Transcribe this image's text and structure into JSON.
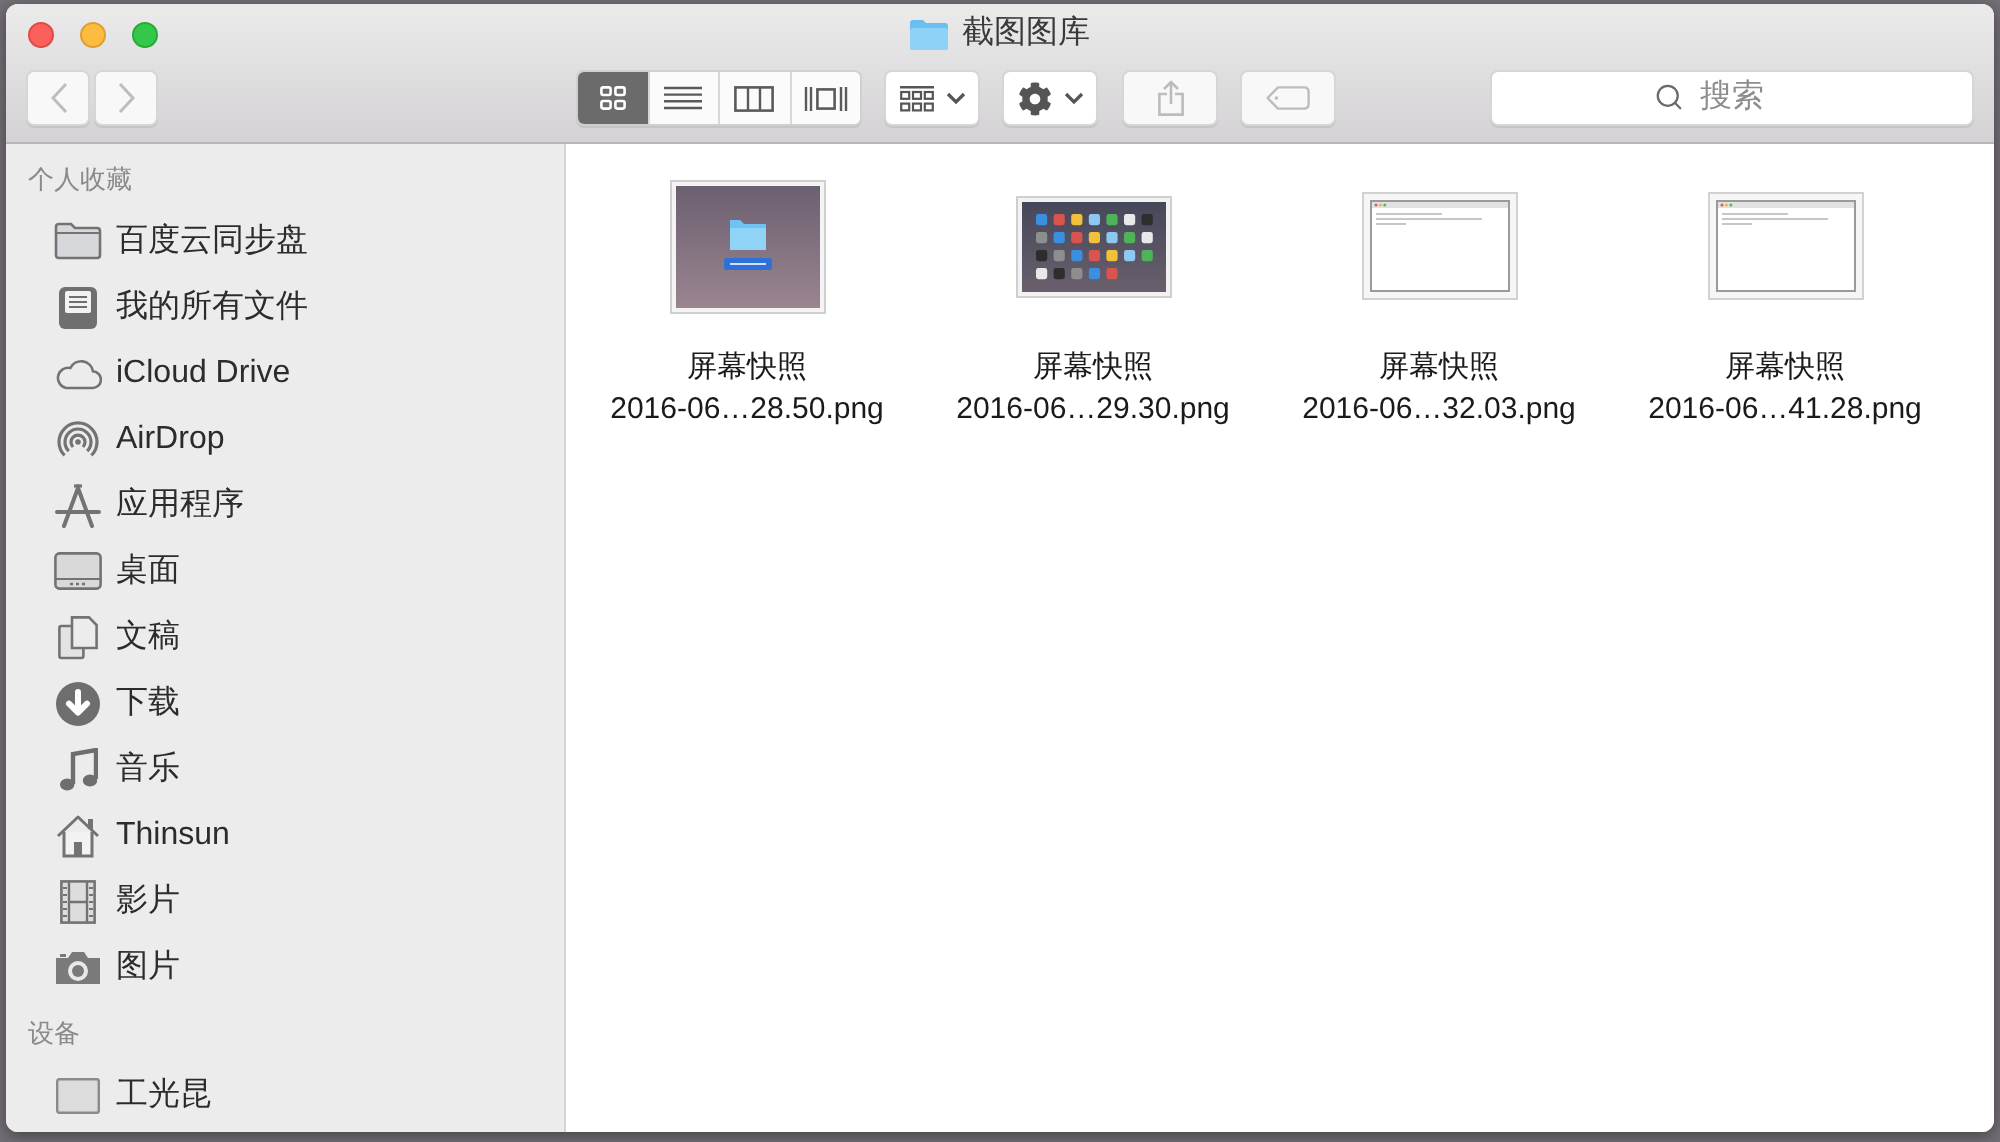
{
  "window": {
    "title": "截图图库"
  },
  "toolbar": {
    "navigation": [
      {
        "kind": "back",
        "disabled": true
      },
      {
        "kind": "forward",
        "disabled": true
      }
    ],
    "view_modes": [
      {
        "kind": "icon",
        "selected": true
      },
      {
        "kind": "list",
        "selected": false
      },
      {
        "kind": "column",
        "selected": false
      },
      {
        "kind": "cover_flow",
        "selected": false
      }
    ],
    "buttons": [
      {
        "kind": "arrange",
        "disabled": false
      },
      {
        "kind": "action",
        "disabled": false
      },
      {
        "kind": "share",
        "disabled": true
      },
      {
        "kind": "tag",
        "disabled": true
      }
    ],
    "search": {
      "placeholder": "搜索"
    }
  },
  "sidebar": {
    "sections": [
      {
        "title": "个人收藏",
        "items": [
          {
            "kind": "folder",
            "label": "百度云同步盘"
          },
          {
            "kind": "all_files",
            "label": "我的所有文件"
          },
          {
            "kind": "icloud",
            "label": "iCloud Drive"
          },
          {
            "kind": "airdrop",
            "label": "AirDrop"
          },
          {
            "kind": "applications",
            "label": "应用程序"
          },
          {
            "kind": "desktop",
            "label": "桌面"
          },
          {
            "kind": "documents",
            "label": "文稿"
          },
          {
            "kind": "downloads",
            "label": "下载"
          },
          {
            "kind": "music",
            "label": "音乐"
          },
          {
            "kind": "home",
            "label": "Thinsun"
          },
          {
            "kind": "movies",
            "label": "影片"
          },
          {
            "kind": "pictures",
            "label": "图片"
          }
        ]
      },
      {
        "title": "设备",
        "items": [
          {
            "kind": "device",
            "label": "工光昆"
          }
        ]
      }
    ]
  },
  "files": [
    {
      "kind": "desktop",
      "label_lines": [
        "屏幕快照",
        "2016-06…28.50.png"
      ]
    },
    {
      "kind": "launchpad",
      "label_lines": [
        "屏幕快照",
        "2016-06…29.30.png"
      ]
    },
    {
      "kind": "document",
      "label_lines": [
        "屏幕快照",
        "2016-06…32.03.png"
      ]
    },
    {
      "kind": "document",
      "label_lines": [
        "屏幕快照",
        "2016-06…41.28.png"
      ]
    }
  ]
}
